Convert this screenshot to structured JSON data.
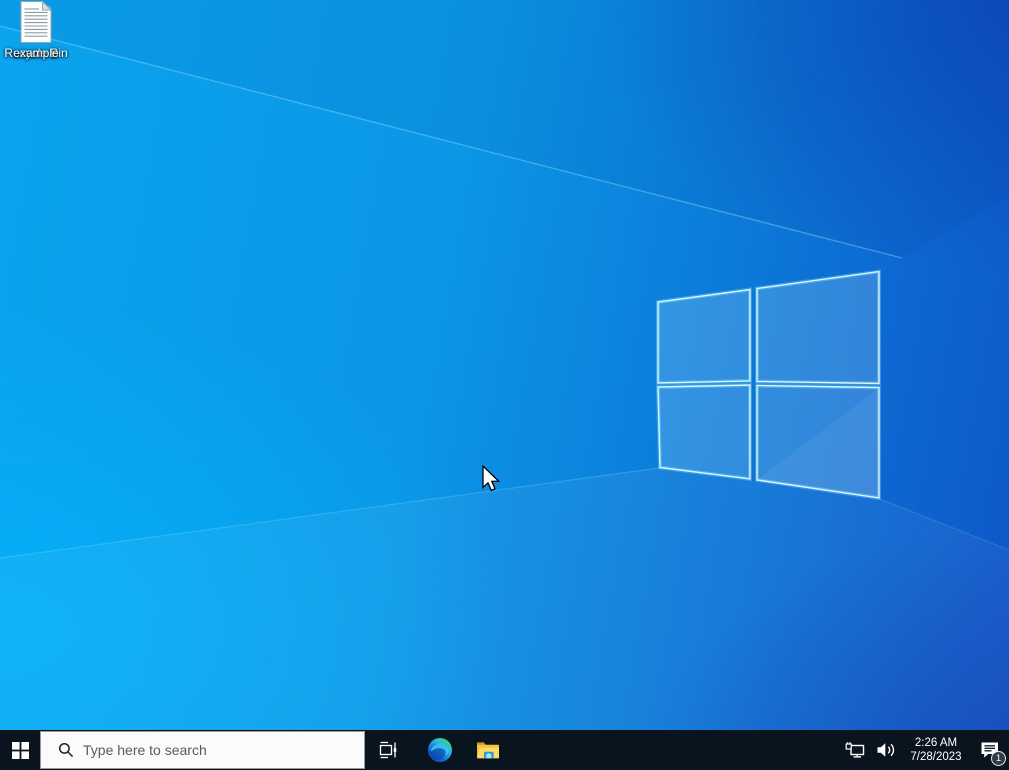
{
  "desktop": {
    "icons": [
      {
        "name": "recycle-bin",
        "label": "Recycle Bin"
      },
      {
        "name": "example-document",
        "label": "example"
      }
    ]
  },
  "taskbar": {
    "search": {
      "placeholder": "Type here to search"
    },
    "tray": {
      "clock": {
        "time": "2:26 AM",
        "date": "7/28/2023"
      },
      "action_center": {
        "badge": "1"
      }
    }
  },
  "colors": {
    "taskbar_bg": "#0a141e",
    "search_bg": "#fbfbfb",
    "wallpaper_left": "#06aaf2",
    "wallpaper_right": "#0e52c6",
    "logo_glow": "#9fe8ff",
    "badge_bg": "#2f3c46"
  }
}
